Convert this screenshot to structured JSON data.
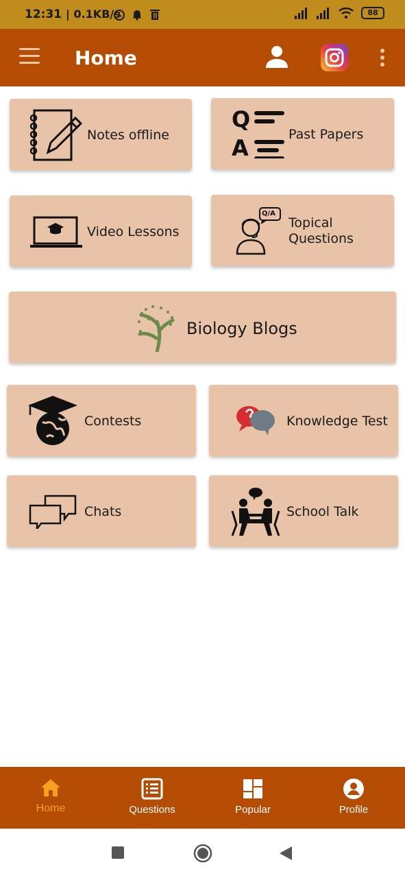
{
  "status_bar": {
    "time": "12:31",
    "speed": "| 0.1KB/s",
    "battery": "88"
  },
  "app_bar": {
    "title": "Home"
  },
  "cards": {
    "notes_offline": "Notes offline",
    "past_papers": "Past Papers",
    "video_lessons": "Video Lessons",
    "topical_questions_line1": "Topical",
    "topical_questions_line2": "Questions",
    "biology_blogs": "Biology Blogs",
    "contests": "Contests",
    "knowledge_test": "Knowledge Test",
    "chats": "Chats",
    "school_talk": "School Talk"
  },
  "past_papers_icon": {
    "q": "Q",
    "a": "A"
  },
  "topical_icon": {
    "bubble": "Q/A"
  },
  "bottom_nav": {
    "home": "Home",
    "questions": "Questions",
    "popular": "Popular",
    "profile": "Profile",
    "active": "home",
    "active_color": "#f7a020"
  },
  "colors": {
    "status_bar": "#c08c1c",
    "app_bar": "#b44c04",
    "card": "#e9c3a8"
  }
}
